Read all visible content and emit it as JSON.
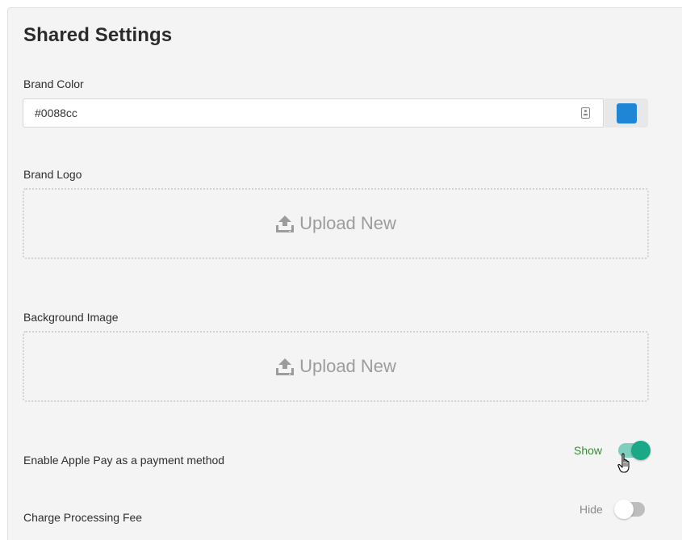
{
  "panel": {
    "title": "Shared Settings"
  },
  "brand_color": {
    "label": "Brand Color",
    "value": "#0088cc",
    "swatch_color": "#1f86d6",
    "field_icon": "contact-card-icon"
  },
  "brand_logo": {
    "label": "Brand Logo",
    "upload_label": "Upload New",
    "icon": "upload-icon"
  },
  "background_image": {
    "label": "Background Image",
    "upload_label": "Upload New",
    "icon": "upload-icon"
  },
  "apple_pay": {
    "label": "Enable Apple Pay as a payment method",
    "state_label": "Show",
    "enabled": true,
    "state_color": "#3a8a3a",
    "track_color": "#7fcfbf",
    "knob_color": "#1aa889"
  },
  "processing_fee": {
    "label": "Charge Processing Fee",
    "state_label": "Hide",
    "enabled": false,
    "state_color": "#8a8a8a",
    "track_color": "#bdbdbd",
    "knob_color": "#ffffff"
  },
  "cursor": {
    "icon": "hand-pointer-icon"
  }
}
